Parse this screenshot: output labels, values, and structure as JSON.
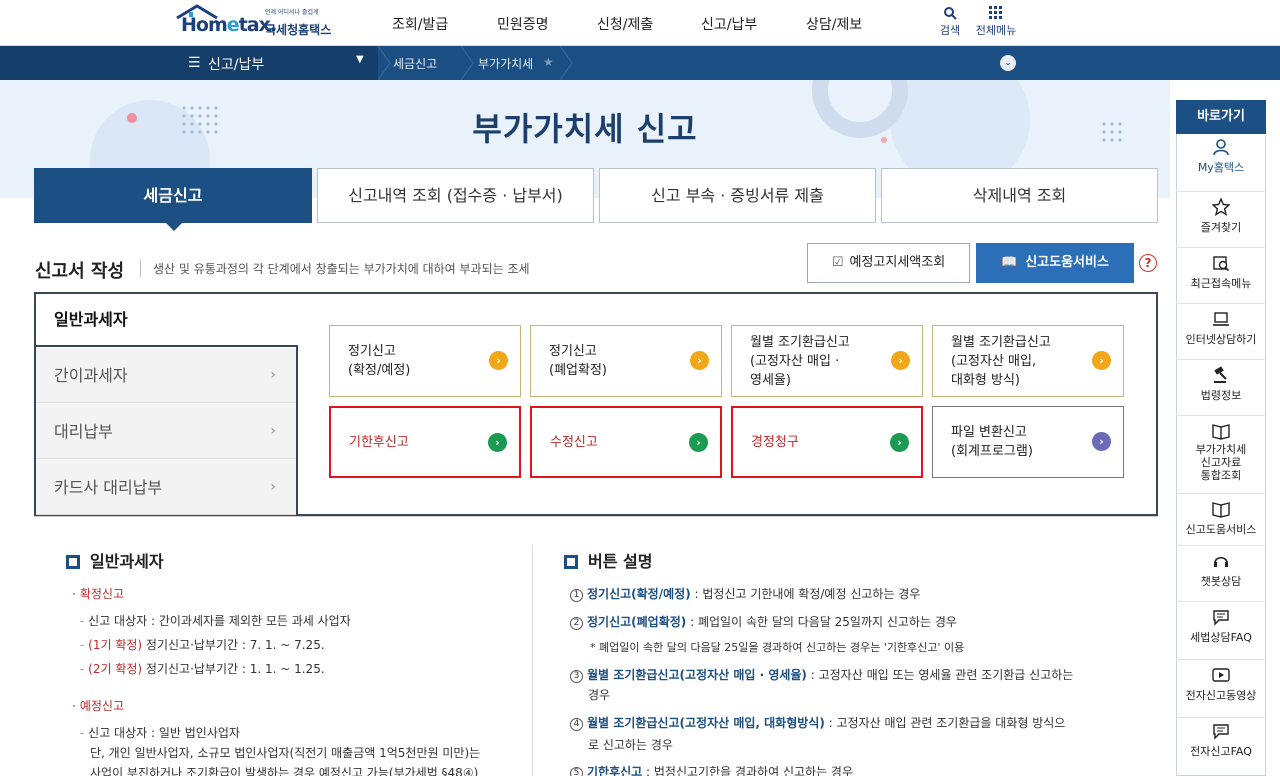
{
  "header": {
    "logo_small": "언제 어디서나 즐겁게",
    "logo_brand_a": "Hom",
    "logo_brand_b": "e",
    "logo_brand_c": "tax.",
    "logo_kr": "국세청홈택스",
    "menu": [
      "조회/발급",
      "민원증명",
      "신청/제출",
      "신고/납부",
      "상담/제보"
    ],
    "search_label": "검색",
    "allmenu_label": "전체메뉴"
  },
  "navbar": {
    "current": "신고/납부",
    "crumbs": [
      "세금신고",
      "부가가치세"
    ]
  },
  "page_title": "부가가치세 신고",
  "tabs": [
    "세금신고",
    "신고내역 조회 (접수증 · 납부서)",
    "신고 부속 · 증빙서류 제출",
    "삭제내역 조회"
  ],
  "section": {
    "title": "신고서 작성",
    "desc": "생산 및 유통과정의 각 단계에서 창출되는 부가가치에 대하여 부과되는 조세",
    "btn_notice": "예정고지세액조회",
    "btn_help": "신고도움서비스",
    "help_q": "?"
  },
  "left_tabs": [
    "일반과세자",
    "간이과세자",
    "대리납부",
    "카드사 대리납부"
  ],
  "cards": [
    {
      "l1": "정기신고",
      "l2": "(확정/예정)",
      "l3": ""
    },
    {
      "l1": "정기신고",
      "l2": "(폐업확정)",
      "l3": ""
    },
    {
      "l1": "월별 조기환급신고",
      "l2": "(고정자산 매입 ·",
      "l3": "영세율)"
    },
    {
      "l1": "월별 조기환급신고",
      "l2": "(고정자산 매입,",
      "l3": "대화형 방식)"
    },
    {
      "l1": "기한후신고",
      "l2": "",
      "l3": ""
    },
    {
      "l1": "수정신고",
      "l2": "",
      "l3": ""
    },
    {
      "l1": "경정청구",
      "l2": "",
      "l3": ""
    },
    {
      "l1": "파일 변환신고",
      "l2": "(회계프로그램)",
      "l3": ""
    }
  ],
  "general": {
    "title": "일반과세자",
    "confirm_head": "확정신고",
    "confirm_1": "신고 대상자 : 간이과세자를 제외한 모든 과세 사업자",
    "confirm_2a": "(1기 확정)",
    "confirm_2b": " 정기신고·납부기간 : 7. 1. ~ 7.25.",
    "confirm_3a": "(2기 확정)",
    "confirm_3b": " 정기신고·납부기간 : 1. 1. ~ 1.25.",
    "prelim_head": "예정신고",
    "prelim_1": "신고 대상자 : 일반 법인사업자",
    "prelim_2": "단, 개인 일반사업자, 소규모 법인사업자(직전기 매출금액 1억5천만원 미만)는",
    "prelim_3": "사업이 부진하거나 조기환급이 발생하는 경우 예정신고 가능(부가세법 §48④)"
  },
  "buttons_desc": {
    "title": "버튼 설명",
    "items": [
      {
        "num": "1",
        "head": "정기신고(확정/예정)",
        "text": " : 법정신고 기한내에 확정/예정 신고하는 경우",
        "extra": ""
      },
      {
        "num": "2",
        "head": "정기신고(폐업확정)",
        "text": " : 폐업일이 속한 달의 다음달 25일까지 신고하는 경우",
        "extra": "* 폐업일이 속한 달의 다음달 25일을 경과하여 신고하는 경우는 '기한후신고' 이용"
      },
      {
        "num": "3",
        "head": "월별 조기환급신고(고정자산 매입 · 영세율)",
        "text": " : 고정자산 매입 또는 영세율 관련 조기환급 신고하는",
        "extra": "경우"
      },
      {
        "num": "4",
        "head": "월별 조기환급신고(고정자산 매입, 대화형방식)",
        "text": " : 고정자산 매입 관련 조기환급을 대화형 방식으",
        "extra": "로 신고하는 경우"
      },
      {
        "num": "5",
        "head": "기한후신고",
        "text": " : 법정신고기한을 경과하여 신고하는 경우",
        "extra": ""
      }
    ]
  },
  "side": {
    "head": "바로가기",
    "items": [
      "My홈택스",
      "즐겨찾기",
      "최근접속메뉴",
      "인터넷상담하기",
      "법령정보",
      "부가가치세",
      "신고자료",
      "통합조회",
      "신고도움서비스",
      "챗봇상담",
      "세법상담FAQ",
      "전자신고동영상",
      "전자신고FAQ"
    ]
  },
  "colors": {
    "navy": "#1c4f84",
    "highlight_red": "#e0141e",
    "go_yellow": "#f0a818",
    "go_green": "#1b9a52",
    "go_purple": "#6b6bb8"
  }
}
